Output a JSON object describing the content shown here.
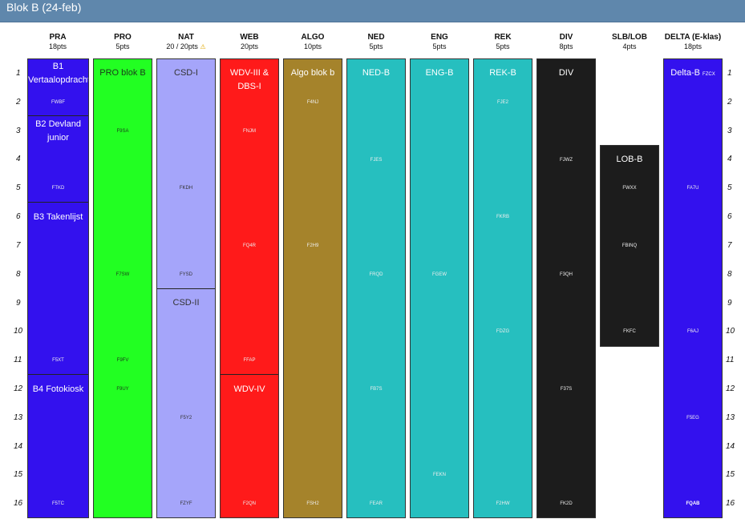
{
  "window": {
    "title": "Blok B (24-feb)"
  },
  "rows": [
    "1",
    "2",
    "3",
    "4",
    "5",
    "6",
    "7",
    "8",
    "9",
    "10",
    "11",
    "12",
    "13",
    "14",
    "15",
    "16"
  ],
  "columns": [
    {
      "key": "pra",
      "name": "PRA",
      "pts": "18pts",
      "color": "#3311ee",
      "titles": [
        "B1 Vertaalopdracht",
        "B2 Devland junior",
        "B3 Takenlijst",
        "B4 Fotokiosk"
      ],
      "codes": [
        "FWBF",
        "FTKD",
        "F5XT",
        "F5TC"
      ]
    },
    {
      "key": "pro",
      "name": "PRO",
      "pts": "5pts",
      "color": "#22ff22",
      "titles": [
        "PRO blok B"
      ],
      "codes": [
        "F9SA",
        "F7SW",
        "F9FV",
        "F9UY"
      ]
    },
    {
      "key": "nat",
      "name": "NAT",
      "pts": "20 / 20pts",
      "warning": "⚠",
      "color": "#a5a5fa",
      "titles": [
        "CSD-I",
        "CSD-II"
      ],
      "codes": [
        "FKDH",
        "FYSD",
        "F5Y2",
        "FZYF"
      ]
    },
    {
      "key": "web",
      "name": "WEB",
      "pts": "20pts",
      "color": "#ff1a1a",
      "titles": [
        "WDV-III & DBS-I",
        "WDV-IV"
      ],
      "codes": [
        "FNJM",
        "FQ4R",
        "FFAP",
        "F2QN"
      ]
    },
    {
      "key": "algo",
      "name": "ALGO",
      "pts": "10pts",
      "color": "#a5832b",
      "titles": [
        "Algo blok b"
      ],
      "codes": [
        "F4NJ",
        "F2H9",
        "FSH2"
      ]
    },
    {
      "key": "ned",
      "name": "NED",
      "pts": "5pts",
      "color": "#26bfbf",
      "titles": [
        "NED-B"
      ],
      "codes": [
        "FJES",
        "FRQD",
        "FB7S",
        "FEAR"
      ]
    },
    {
      "key": "eng",
      "name": "ENG",
      "pts": "5pts",
      "color": "#26bfbf",
      "titles": [
        "ENG-B"
      ],
      "codes": [
        "FGEW",
        "FEKN"
      ]
    },
    {
      "key": "rek",
      "name": "REK",
      "pts": "5pts",
      "color": "#26bfbf",
      "titles": [
        "REK-B"
      ],
      "codes": [
        "FJE2",
        "FKRB",
        "FDZG",
        "F2HW"
      ]
    },
    {
      "key": "div",
      "name": "DIV",
      "pts": "8pts",
      "color": "#1c1c1c",
      "titles": [
        "DIV"
      ],
      "codes": [
        "FJWZ",
        "F3QH",
        "F37S",
        "FK2D"
      ]
    },
    {
      "key": "slb",
      "name": "SLB/LOB",
      "pts": "4pts",
      "color": "#1c1c1c",
      "titles": [
        "LOB-B"
      ],
      "codes": [
        "FWXX",
        "FBINQ",
        "FKFC"
      ]
    },
    {
      "key": "delta",
      "name": "DELTA (E-klas)",
      "pts": "18pts",
      "color": "#3311ee",
      "titles": [
        "Delta-B"
      ],
      "title_code": "FZCX",
      "codes": [
        "FA7U",
        "F6AJ",
        "F5EG",
        "FQAB"
      ]
    }
  ]
}
